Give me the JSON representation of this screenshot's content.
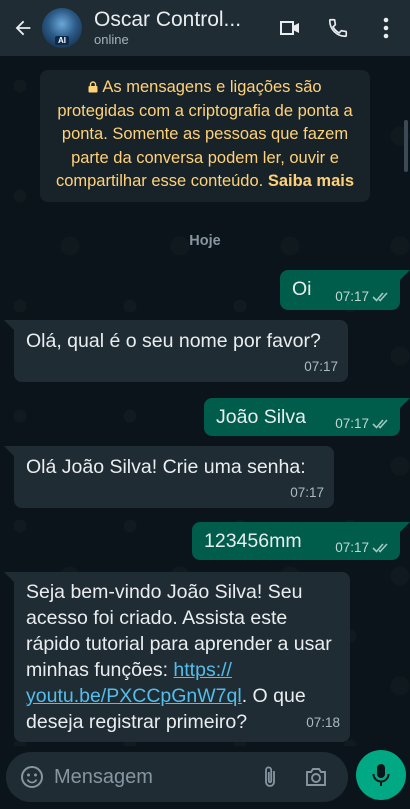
{
  "header": {
    "contact_name": "Oscar Control...",
    "status": "online",
    "avatar_badge": "AI",
    "icons": [
      "back-arrow-icon",
      "video-call-icon",
      "voice-call-icon",
      "more-vert-icon"
    ]
  },
  "chat": {
    "encryption_notice": "As mensagens e ligações são protegidas com a criptografia de ponta a ponta. Somente as pessoas que fazem parte da conversa podem ler, ouvir e compartilhar esse conteúdo.",
    "encryption_link": "Saiba mais",
    "day_label": "Hoje",
    "messages": [
      {
        "direction": "out",
        "text": "Oi",
        "time": "07:17",
        "read": true
      },
      {
        "direction": "in",
        "text": "Olá, qual é o seu nome por favor?",
        "time": "07:17"
      },
      {
        "direction": "out",
        "text": "João Silva",
        "time": "07:17",
        "read": true
      },
      {
        "direction": "in",
        "text": "Olá João Silva! Crie uma senha:",
        "time": "07:17"
      },
      {
        "direction": "out",
        "text": "123456mm",
        "time": "07:17",
        "read": true
      },
      {
        "direction": "in",
        "text_before": "Seja bem-vindo João Silva! Seu acesso foi criado. Assista este rápido tutorial para aprender a usar minhas funções: ",
        "link": "https:// youtu.be/PXCCpGnW7ql",
        "text_after": ". O que deseja registrar primeiro?",
        "time": "07:18"
      }
    ]
  },
  "composer": {
    "placeholder": "Mensagem"
  },
  "colors": {
    "background": "#0b141a",
    "header": "#1f2c34",
    "outgoing_bubble": "#005c4b",
    "incoming_bubble": "#202c33",
    "notice_text": "#ffd279",
    "link": "#53bdeb",
    "accent": "#00a884"
  }
}
